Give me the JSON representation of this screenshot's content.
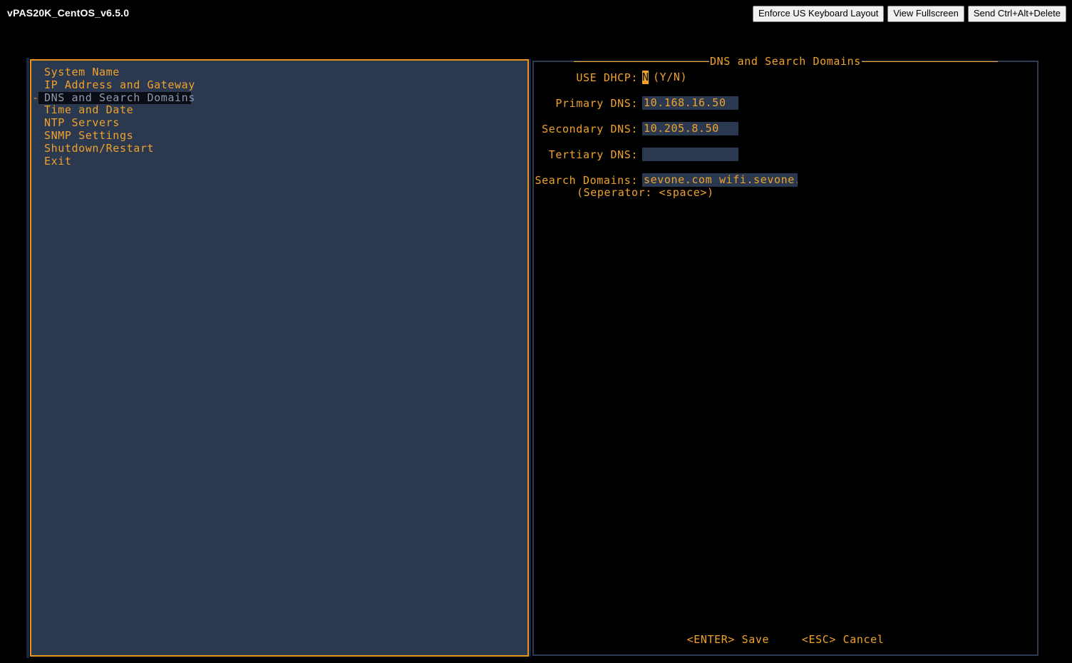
{
  "console": {
    "title": "vPAS20K_CentOS_v6.5.0",
    "buttons": [
      {
        "label": "Enforce US Keyboard Layout",
        "name": "enforce-us-keyboard-layout-button"
      },
      {
        "label": "View Fullscreen",
        "name": "view-fullscreen-button"
      },
      {
        "label": "Send Ctrl+Alt+Delete",
        "name": "send-ctrl-alt-delete-button"
      }
    ]
  },
  "colors": {
    "background": "#000000",
    "accent_orange": "#f0a22a",
    "panel_fill": "#2b3950",
    "panel_border_orange": "#e8921f",
    "panel_border_blue": "#2d3c52",
    "selected_bg": "#0a0d14",
    "selected_fg": "#8d9bb0",
    "field_bg": "#2b3950"
  },
  "menu": {
    "selected_index": 2,
    "selected_marker": "-",
    "items": [
      {
        "label": "System Name"
      },
      {
        "label": "IP Address and Gateway"
      },
      {
        "label": "DNS and Search Domains"
      },
      {
        "label": "Time and Date"
      },
      {
        "label": "NTP Servers"
      },
      {
        "label": "SNMP Settings"
      },
      {
        "label": "Shutdown/Restart"
      },
      {
        "label": "Exit"
      }
    ]
  },
  "form": {
    "title": "DNS and Search Domains",
    "title_dash_left": "——————————————————————",
    "title_dash_right": "——————————————————————",
    "dhcp": {
      "label": "USE DHCP:",
      "value": "N",
      "hint": "(Y/N)",
      "cursor": true
    },
    "primary_dns": {
      "label": "Primary DNS:",
      "value": "10.168.16.50",
      "placeholder": ""
    },
    "secondary_dns": {
      "label": "Secondary DNS:",
      "value": "10.205.8.50",
      "placeholder": ""
    },
    "tertiary_dns": {
      "label": "Tertiary DNS:",
      "value": "",
      "placeholder": ""
    },
    "search_domains": {
      "label": "Search Domains:",
      "value": "sevone.com wifi.sevone.c",
      "placeholder": "",
      "note": "(Seperator: <space>)"
    },
    "actions": [
      {
        "label": "<ENTER> Save",
        "name": "save-action"
      },
      {
        "label": "<ESC> Cancel",
        "name": "cancel-action"
      }
    ]
  }
}
